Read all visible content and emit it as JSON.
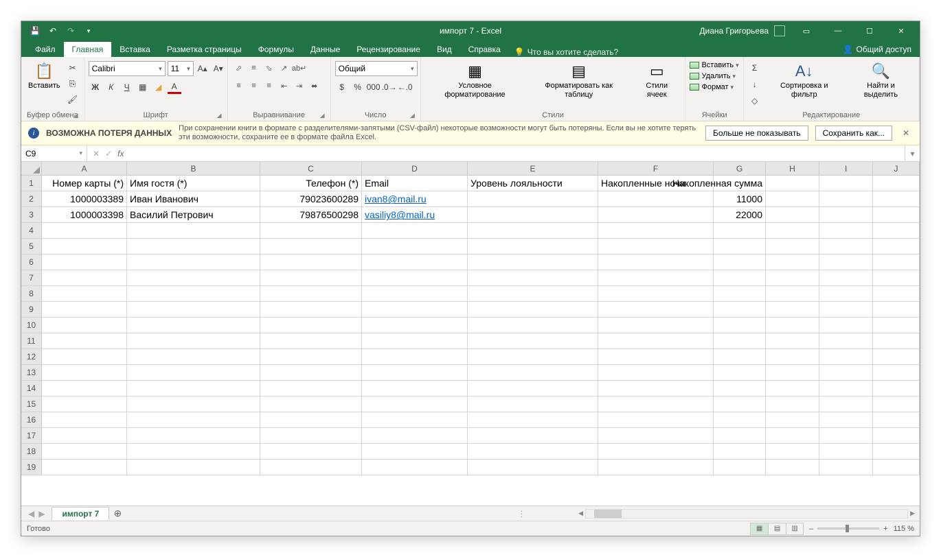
{
  "app": {
    "title": "импорт 7 - Excel",
    "user": "Диана Григорьева"
  },
  "tabs": {
    "file": "Файл",
    "home": "Главная",
    "insert": "Вставка",
    "layout": "Разметка страницы",
    "formulas": "Формулы",
    "data": "Данные",
    "review": "Рецензирование",
    "view": "Вид",
    "help": "Справка",
    "tellme": "Что вы хотите сделать?",
    "share": "Общий доступ"
  },
  "ribbon": {
    "clipboard": {
      "label": "Буфер обмена",
      "paste": "Вставить"
    },
    "font": {
      "label": "Шрифт",
      "name": "Calibri",
      "size": "11"
    },
    "alignment": {
      "label": "Выравнивание"
    },
    "number": {
      "label": "Число",
      "format": "Общий"
    },
    "styles": {
      "label": "Стили",
      "cond": "Условное форматирование",
      "table": "Форматировать как таблицу",
      "cell": "Стили ячеек"
    },
    "cells": {
      "label": "Ячейки",
      "insert": "Вставить",
      "delete": "Удалить",
      "format": "Формат"
    },
    "editing": {
      "label": "Редактирование",
      "sort": "Сортировка и фильтр",
      "find": "Найти и выделить"
    }
  },
  "warn": {
    "title": "ВОЗМОЖНА ПОТЕРЯ ДАННЫХ",
    "msg": "При сохранении книги в формате с разделителями-запятыми (CSV-файл) некоторые возможности могут быть потеряны. Если вы не хотите терять эти возможности, сохраните ее в формате файла Excel.",
    "dismiss": "Больше не показывать",
    "saveas": "Сохранить как..."
  },
  "namebox": "C9",
  "columns": [
    "A",
    "B",
    "C",
    "D",
    "E",
    "F",
    "G",
    "H",
    "I",
    "J"
  ],
  "headers": {
    "A": "Номер карты (*)",
    "B": "Имя гостя (*)",
    "C": "Телефон (*)",
    "D": "Email",
    "E": "Уровень лояльности",
    "F": "Накопленные ночи",
    "G": "Накопленная сумма"
  },
  "rows": [
    {
      "A": "1000003389",
      "B": "Иван Иванович",
      "C": "79023600289",
      "D": "ivan8@mail.ru",
      "G": "11000"
    },
    {
      "A": "1000003398",
      "B": "Василий Петрович",
      "C": "79876500298",
      "D": "vasiliy8@mail.ru",
      "G": "22000"
    }
  ],
  "sheet": "импорт 7",
  "status": {
    "ready": "Готово",
    "zoom": "115 %"
  }
}
